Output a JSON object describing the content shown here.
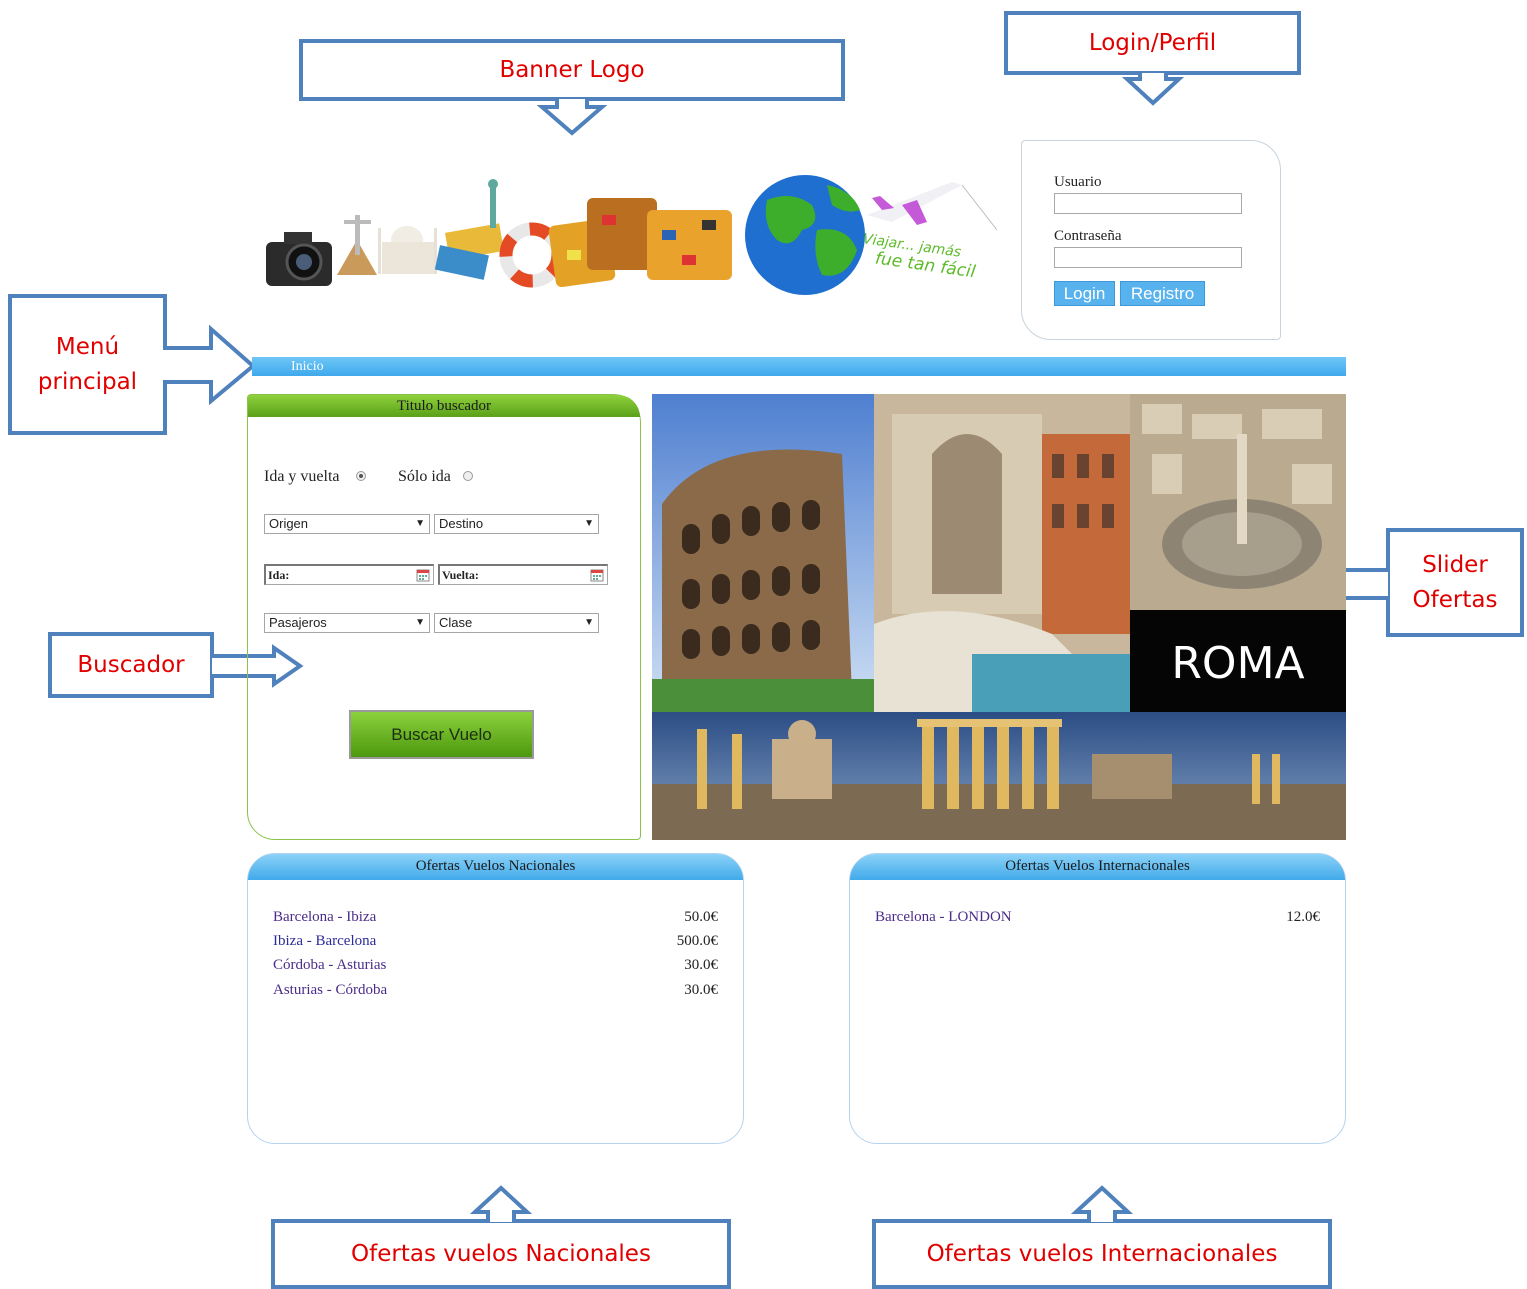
{
  "annotations": {
    "banner_logo": "Banner Logo",
    "login_perfil": "Login/Perfil",
    "menu_principal": "Menú principal",
    "buscador": "Buscador",
    "slider_ofertas": "Slider Ofertas",
    "ofertas_nacionales": "Ofertas vuelos Nacionales",
    "ofertas_internacionales": "Ofertas vuelos Internacionales"
  },
  "banner": {
    "slogan_line1": "Viajar... jamás",
    "slogan_line2": "fue tan fácil"
  },
  "login": {
    "user_label": "Usuario",
    "password_label": "Contraseña",
    "login_button": "Login",
    "register_button": "Registro"
  },
  "menu": {
    "items": [
      {
        "label": "Inicio"
      }
    ]
  },
  "search": {
    "title": "Titulo buscador",
    "trip_round": "Ida y vuelta",
    "trip_oneway": "Sólo ida",
    "origin": "Origen",
    "destination": "Destino",
    "departure": "Ida:",
    "return": "Vuelta:",
    "passengers": "Pasajeros",
    "class": "Clase",
    "submit": "Buscar Vuelo"
  },
  "slider": {
    "caption": "ROMA"
  },
  "offers_national": {
    "title": "Ofertas Vuelos Nacionales",
    "rows": [
      {
        "route": "Barcelona - Ibiza",
        "price": "50.0€"
      },
      {
        "route": "Ibiza - Barcelona",
        "price": "500.0€"
      },
      {
        "route": "Córdoba - Asturias",
        "price": "30.0€"
      },
      {
        "route": "Asturias - Córdoba",
        "price": "30.0€"
      }
    ]
  },
  "offers_international": {
    "title": "Ofertas Vuelos Internacionales",
    "rows": [
      {
        "route": "Barcelona - LONDON",
        "price": "12.0€"
      }
    ]
  }
}
